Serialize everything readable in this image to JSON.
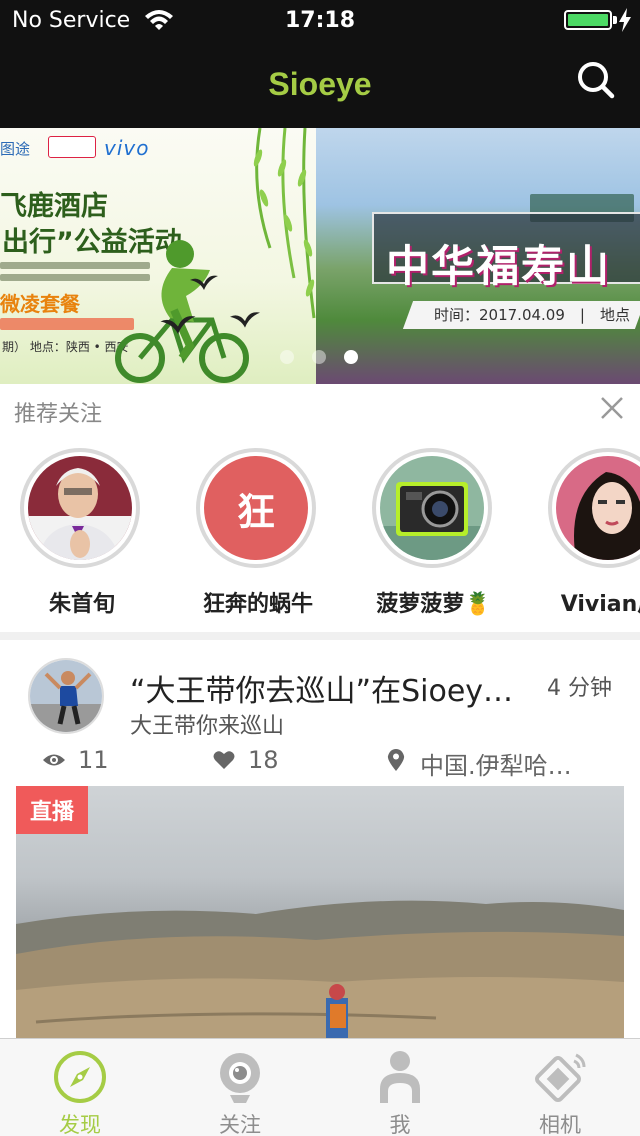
{
  "status_bar": {
    "carrier": "No Service",
    "time": "17:18",
    "battery_level": 1.0,
    "battery_color": "#4cd964"
  },
  "nav": {
    "title": "Sioeye",
    "title_color": "#a5cc45",
    "search_icon": "search-icon"
  },
  "banner": {
    "slides": [
      {
        "logos": [
          "图途",
          "vivo"
        ],
        "title_line1": "飞鹿酒店",
        "title_line2": "出行”公益活动",
        "package": "微凌套餐",
        "info": "期） 地点：陕西 • 西安"
      },
      {
        "title": "中华福寿山",
        "time": "时间：2017.04.09　|　地点"
      }
    ],
    "page_count": 3,
    "active_page": 3
  },
  "recommend": {
    "title": "推荐关注",
    "close_icon": "close-icon",
    "users": [
      {
        "name": "朱首旬"
      },
      {
        "name": "狂奔的蜗牛",
        "initial": "狂"
      },
      {
        "name": "菠萝菠萝🍍"
      },
      {
        "name": "Vivian风"
      }
    ]
  },
  "feed": {
    "title": "“大王带你去巡山”在Sioeye直播",
    "time_ago": "4 分钟",
    "subtitle": "大王带你来巡山",
    "views": "11",
    "likes": "18",
    "location": "中国.伊犁哈萨克",
    "live_label": "直播",
    "live_color": "#f05a5a"
  },
  "tabs": [
    {
      "label": "发现",
      "icon": "compass-icon",
      "active": true
    },
    {
      "label": "关注",
      "icon": "webcam-icon",
      "active": false
    },
    {
      "label": "我",
      "icon": "person-icon",
      "active": false
    },
    {
      "label": "相机",
      "icon": "camera-device-icon",
      "active": false
    }
  ]
}
